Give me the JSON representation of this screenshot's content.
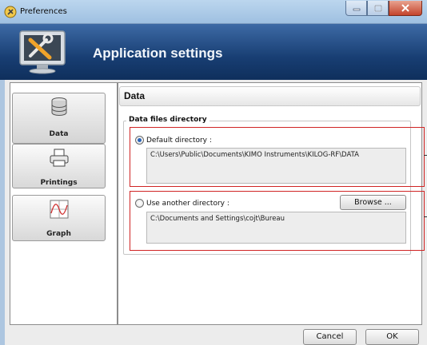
{
  "window": {
    "title": "Preferences",
    "controls": [
      "minimize-icon",
      "maximize-icon",
      "close-icon"
    ]
  },
  "banner": {
    "title": "Application settings",
    "logo": "tools-monitor-icon"
  },
  "sidebar": {
    "items": [
      {
        "label": "Data",
        "icon": "database-icon",
        "selected": true
      },
      {
        "label": "Printings",
        "icon": "printer-icon",
        "selected": false
      },
      {
        "label": "Graph",
        "icon": "graph-icon",
        "selected": false
      }
    ]
  },
  "section": {
    "title": "Data",
    "group_title": "Data files directory",
    "default_option": {
      "label": "Default directory :",
      "path": "C:\\Users\\Public\\Documents\\KIMO Instruments\\KILOG-RF\\DATA",
      "selected": true
    },
    "other_option": {
      "label": "Use another directory :",
      "path": "C:\\Documents and Settings\\cojt\\Bureau",
      "selected": false,
      "browse_label": "Browse ..."
    }
  },
  "footer": {
    "cancel_label": "Cancel",
    "ok_label": "OK"
  },
  "colors": {
    "banner": "#183e73",
    "highlight": "#d02424",
    "radio_selected": "#2a64b8"
  }
}
